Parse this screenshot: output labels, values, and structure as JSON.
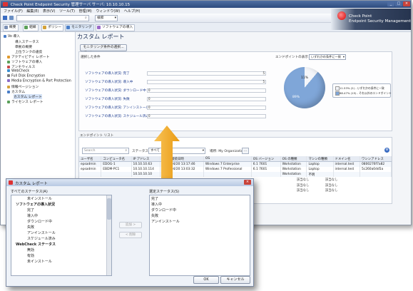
{
  "window": {
    "title": "Check Point Endpoint Security 管理サーバ サーバ: 10.10.10.15",
    "controls": [
      "_",
      "□",
      "×"
    ]
  },
  "menu": [
    "ファイル(F)",
    "編集(E)",
    "表示(V)",
    "ツール(T)",
    "管理(M)",
    "ウィンドウ(W)",
    "ヘルプ(H)"
  ],
  "search": {
    "placeholder": "検索",
    "scope": "検索"
  },
  "toolbar_tabs": [
    "概要",
    "組織",
    "ポリシー",
    "モニタリング",
    "ソフトウェアの導入"
  ],
  "logo": {
    "line1": "Check Point",
    "line2": "Endpoint Security Management"
  },
  "sidebar": {
    "items": [
      {
        "label": "Vo 導入",
        "level": 0
      },
      {
        "label": "導入ステータス",
        "level": 2
      },
      {
        "label": "準拠の概要",
        "level": 2
      },
      {
        "label": "上位ランクの違反",
        "level": 2
      },
      {
        "label": "アクティビティ レポート",
        "level": 1
      },
      {
        "label": "ソフトウェアの導入",
        "level": 1
      },
      {
        "label": "アンチウィルス",
        "level": 1
      },
      {
        "label": "WebCheck",
        "level": 1
      },
      {
        "label": "Full Disk Encryption",
        "level": 1
      },
      {
        "label": "Media Encryption & Port Protection",
        "level": 1
      },
      {
        "label": "情報ページション",
        "level": 1
      },
      {
        "label": "カスタム",
        "level": 1
      },
      {
        "label": "カスタム レポート",
        "level": 2,
        "selected": true
      },
      {
        "label": "ライセンス レポート",
        "level": 1
      }
    ]
  },
  "report": {
    "title": "カスタム レポート",
    "monitor_button": "モニタリング条件の選択...",
    "section_label": "レポート",
    "selected_conditions_label": "選択した条件",
    "endpoint_view_label": "エンドポイントの表示",
    "endpoint_view_value": "いずれかの条件に一致",
    "rows": [
      {
        "label": "ソフトウェアの導入状況: 完了",
        "value": "5"
      },
      {
        "label": "ソフトウェアの導入状況: 導入中",
        "value": "5"
      },
      {
        "label": "ソフトウェアの導入状況: ダウンロード中",
        "value": "0"
      },
      {
        "label": "ソフトウェアの導入状況: 失敗",
        "value": "0"
      },
      {
        "label": "ソフトウェアの導入状況: アンインストール",
        "value": "0"
      },
      {
        "label": "ソフトウェアの導入状況: スケジュール済み",
        "value": "0"
      }
    ]
  },
  "chart_data": {
    "type": "pie",
    "slices": [
      {
        "label": "いずれかの条件に一致",
        "percent": 11,
        "display": "11%"
      },
      {
        "label": "それ以外のエンドポイント",
        "percent": 89,
        "display": "89%"
      }
    ],
    "legend": [
      {
        "label": "11.53% (2) - いずれかの条件に一致",
        "color": "#f2f4f8"
      },
      {
        "label": "88.47% (15) - それ以外のエンドポイント",
        "color": "#7fa6d8"
      }
    ],
    "legend_position": "right"
  },
  "endpoints": {
    "section_label": "エンドポイント リスト",
    "search_placeholder": "Search",
    "status_label": "ステータス:",
    "status_value": "すべて",
    "location_label": "場所: My Organization",
    "columns": [
      "ユーザ名",
      "コンピュータ名",
      "IP アドレス",
      "前回の接続日時",
      "OS",
      "OS バージョン",
      "OS の種類",
      "マシンの種類",
      "ドメイン名",
      "ワシンアドレス"
    ],
    "rows": [
      [
        "epsadmin",
        "EDOG-1",
        "10.10.10.63",
        "2012/04/20 13:17:46",
        "Windows 7 Enterprise",
        "6.1 7601",
        "Workstation",
        "Laptop",
        "internal.test",
        "0800276f7a82"
      ],
      [
        "epsadmin",
        "EBDM-PC1",
        "10.10.10.114",
        "2012/04/20 13:03:32",
        "Windows 7 Professional",
        "6.1 7601",
        "Workstation",
        "Laptop",
        "internal.test",
        "5c260a0dd5a"
      ],
      [
        "",
        "",
        "10.10.10.10",
        "",
        "",
        "",
        "Workstation",
        "不明",
        "",
        ""
      ]
    ],
    "blank_value": "該当なし"
  },
  "dialog": {
    "title": "カスタム レポート",
    "left_header": "すべてのステータス(A)",
    "right_header": "選定ステータス(S)",
    "left_items": [
      {
        "label": "未インストール",
        "bold": false,
        "indent": 2
      },
      {
        "label": "ソフトウェアの導入状況",
        "bold": true,
        "indent": 0
      },
      {
        "label": "完了",
        "bold": false,
        "indent": 2
      },
      {
        "label": "導入中",
        "bold": false,
        "indent": 2
      },
      {
        "label": "ダウンロード中",
        "bold": false,
        "indent": 2
      },
      {
        "label": "失敗",
        "bold": false,
        "indent": 2
      },
      {
        "label": "アンインストール",
        "bold": false,
        "indent": 2
      },
      {
        "label": "スケジュール済み",
        "bold": false,
        "indent": 2
      },
      {
        "label": "WebCheck ステータス",
        "bold": true,
        "indent": 0
      },
      {
        "label": "無効",
        "bold": false,
        "indent": 2
      },
      {
        "label": "有効",
        "bold": false,
        "indent": 2
      },
      {
        "label": "未インストール",
        "bold": false,
        "indent": 2
      }
    ],
    "right_items": [
      "完了",
      "導入中",
      "ダウンロード中",
      "失敗",
      "アンインストール"
    ],
    "add_button": "追加 >",
    "remove_button": "< 削除",
    "ok_button": "OK",
    "cancel_button": "キャンセル"
  },
  "colors": {
    "accent": "#2d4b7e",
    "arrow": "#f6b026",
    "link_text": "#1b3a8e"
  }
}
